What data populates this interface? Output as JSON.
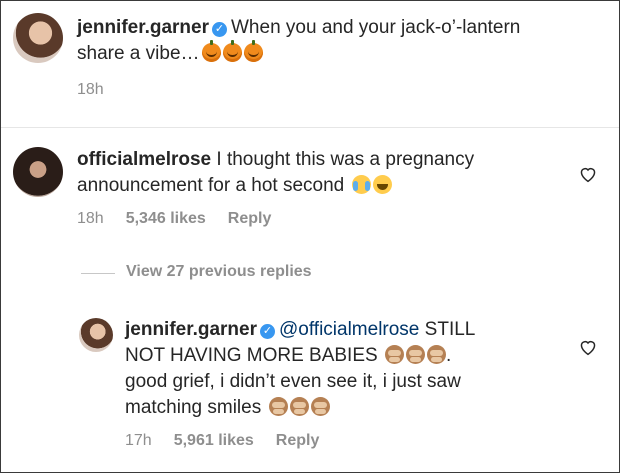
{
  "caption": {
    "username": "jennifer.garner",
    "text": "When you and your jack-o’-lantern",
    "text_line2": "share a vibe…",
    "emojis": [
      "pumpkin",
      "pumpkin",
      "pumpkin"
    ],
    "time": "18h"
  },
  "comment": {
    "username": "officialmelrose",
    "text": "I thought this was a pregnancy",
    "text_line2": "announcement for a hot second",
    "emojis": [
      "crying-face",
      "tears-of-joy-face"
    ],
    "time": "18h",
    "likes": "5,346 likes",
    "reply_label": "Reply"
  },
  "view_replies": "View 27 previous replies",
  "reply": {
    "username": "jennifer.garner",
    "mention": "@officialmelrose",
    "text1": "STILL",
    "text2": "NOT HAVING MORE BABIES",
    "text2_end": ".",
    "text3": "good grief, i didn’t even see it, i just saw",
    "text4": "matching smiles",
    "time": "17h",
    "likes": "5,961 likes",
    "reply_label": "Reply"
  },
  "colors": {
    "verified": "#3897f0",
    "mention": "#003569",
    "meta": "#8e8e8e"
  }
}
